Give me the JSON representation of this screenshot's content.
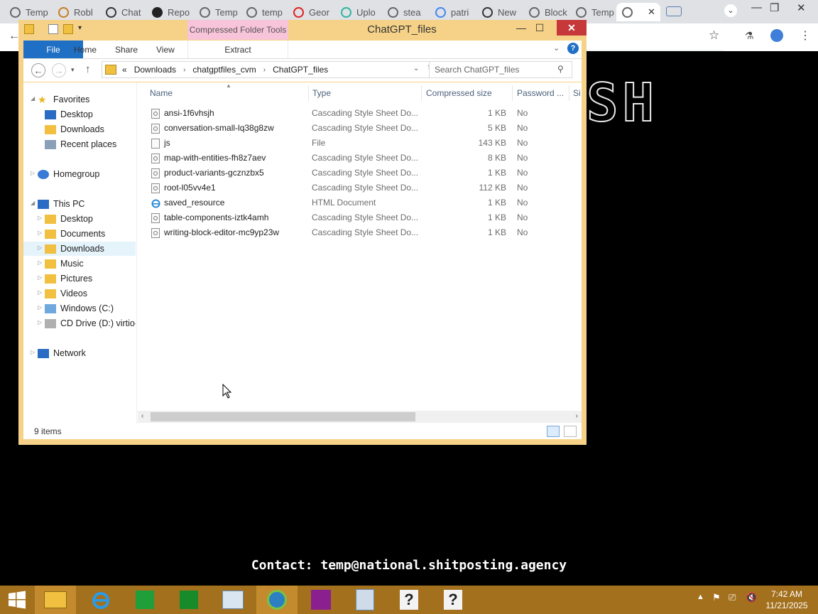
{
  "browser": {
    "tabs": [
      {
        "title": "Temp"
      },
      {
        "title": "Robl"
      },
      {
        "title": "Chat"
      },
      {
        "title": "Repo"
      },
      {
        "title": "Temp"
      },
      {
        "title": "temp"
      },
      {
        "title": "Geor"
      },
      {
        "title": "Uplo"
      },
      {
        "title": "stea"
      },
      {
        "title": "patri"
      },
      {
        "title": "New"
      },
      {
        "title": "Block"
      },
      {
        "title": "Temp"
      },
      {
        "title": ""
      }
    ]
  },
  "page": {
    "big_text": "SH",
    "contact": "Contact: temp@national.shitposting.agency"
  },
  "explorer": {
    "context_tab": "Compressed Folder Tools",
    "title": "ChatGPT_files",
    "ribbon_tabs": [
      "File",
      "Home",
      "Share",
      "View",
      "Extract"
    ],
    "breadcrumb": {
      "overflow": "«",
      "items": [
        "Downloads",
        "chatgptfiles_cvm",
        "ChatGPT_files"
      ]
    },
    "search_placeholder": "Search ChatGPT_files",
    "nav": {
      "favorites": "Favorites",
      "fav_items": [
        "Desktop",
        "Downloads",
        "Recent places"
      ],
      "homegroup": "Homegroup",
      "thispc": "This PC",
      "pc_items": [
        "Desktop",
        "Documents",
        "Downloads",
        "Music",
        "Pictures",
        "Videos",
        "Windows (C:)",
        "CD Drive (D:) virtio-w"
      ],
      "network": "Network"
    },
    "columns": {
      "name": "Name",
      "type": "Type",
      "compressed": "Compressed size",
      "password": "Password ...",
      "size": "Si"
    },
    "files": [
      {
        "name": "ansi-1f6vhsjh",
        "type": "Cascading Style Sheet Do...",
        "size": "1 KB",
        "pw": "No",
        "icon": "css"
      },
      {
        "name": "conversation-small-lq38g8zw",
        "type": "Cascading Style Sheet Do...",
        "size": "5 KB",
        "pw": "No",
        "icon": "css"
      },
      {
        "name": "js",
        "type": "File",
        "size": "143 KB",
        "pw": "No",
        "icon": "file"
      },
      {
        "name": "map-with-entities-fh8z7aev",
        "type": "Cascading Style Sheet Do...",
        "size": "8 KB",
        "pw": "No",
        "icon": "css"
      },
      {
        "name": "product-variants-gcznzbx5",
        "type": "Cascading Style Sheet Do...",
        "size": "1 KB",
        "pw": "No",
        "icon": "css"
      },
      {
        "name": "root-l05vv4e1",
        "type": "Cascading Style Sheet Do...",
        "size": "112 KB",
        "pw": "No",
        "icon": "css"
      },
      {
        "name": "saved_resource",
        "type": "HTML Document",
        "size": "1 KB",
        "pw": "No",
        "icon": "html"
      },
      {
        "name": "table-components-iztk4amh",
        "type": "Cascading Style Sheet Do...",
        "size": "1 KB",
        "pw": "No",
        "icon": "css"
      },
      {
        "name": "writing-block-editor-mc9yp23w",
        "type": "Cascading Style Sheet Do...",
        "size": "1 KB",
        "pw": "No",
        "icon": "css"
      }
    ],
    "status": "9 items"
  },
  "taskbar": {
    "time": "7:42 AM",
    "date": "11/21/2025"
  }
}
